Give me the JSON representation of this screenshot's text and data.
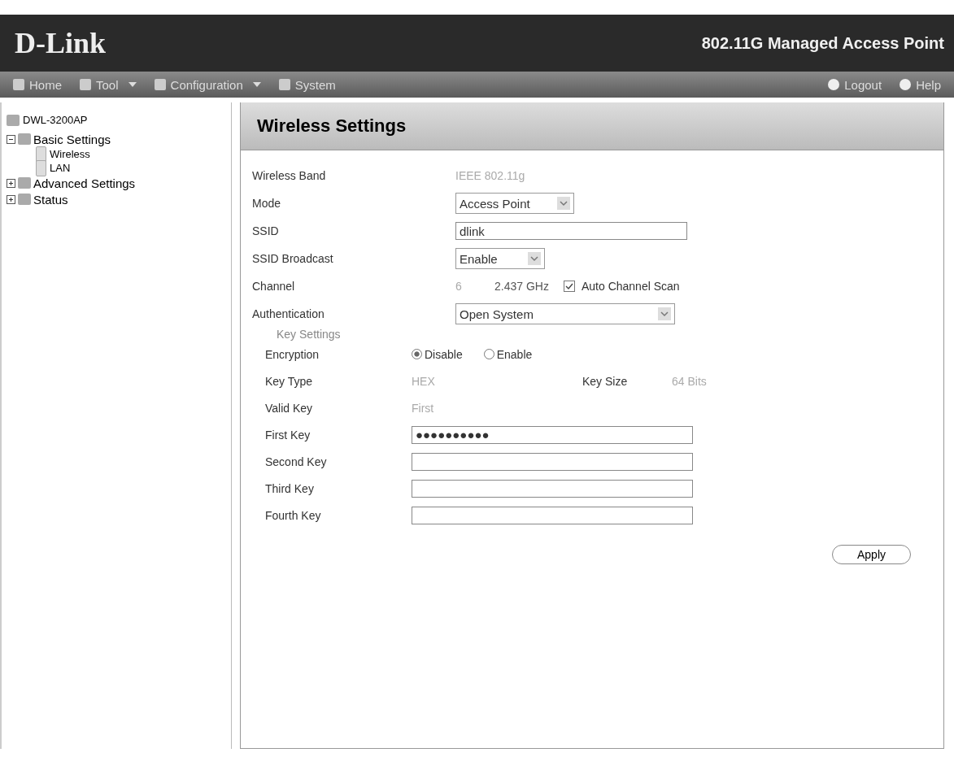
{
  "header": {
    "logo": "D-Link",
    "product": "802.11G Managed Access Point"
  },
  "nav": {
    "left": [
      {
        "label": "Home",
        "dropdown": false
      },
      {
        "label": "Tool",
        "dropdown": true
      },
      {
        "label": "Configuration",
        "dropdown": true
      },
      {
        "label": "System",
        "dropdown": false
      }
    ],
    "right": [
      {
        "label": "Logout"
      },
      {
        "label": "Help"
      }
    ]
  },
  "tree": {
    "root": "DWL-3200AP",
    "items": [
      {
        "label": "Basic Settings",
        "expanded": true,
        "children": [
          {
            "label": "Wireless"
          },
          {
            "label": "LAN"
          }
        ]
      },
      {
        "label": "Advanced Settings",
        "expanded": false
      },
      {
        "label": "Status",
        "expanded": false
      }
    ]
  },
  "panel": {
    "title": "Wireless Settings",
    "rows": [
      {
        "kind": "static",
        "label": "Wireless Band",
        "value": "IEEE 802.11g"
      },
      {
        "kind": "select",
        "label": "Mode",
        "value": "Access Point"
      },
      {
        "kind": "input",
        "label": "SSID",
        "value": "dlink"
      },
      {
        "kind": "select",
        "label": "SSID Broadcast",
        "value": "Enable"
      },
      {
        "kind": "channel",
        "label": "Channel",
        "value": "6",
        "freq": "2.437 GHz",
        "check_label": "Auto Channel Scan",
        "checked": true
      },
      {
        "kind": "select",
        "label": "Authentication",
        "value": "Open System"
      }
    ],
    "section": "Key Settings",
    "key_rows": [
      {
        "kind": "radio",
        "label": "Encryption",
        "options": [
          {
            "label": "Disable",
            "selected": true
          },
          {
            "label": "Enable",
            "selected": false
          }
        ]
      },
      {
        "kind": "pair",
        "label": "Key Type",
        "value": "HEX",
        "label2": "Key Size",
        "value2": "64 Bits"
      },
      {
        "kind": "static",
        "label": "Valid Key",
        "value": "First"
      },
      {
        "kind": "input",
        "label": "First Key",
        "value": "●●●●●●●●●●"
      },
      {
        "kind": "input",
        "label": "Second Key",
        "value": ""
      },
      {
        "kind": "input",
        "label": "Third Key",
        "value": ""
      },
      {
        "kind": "input",
        "label": "Fourth Key",
        "value": ""
      }
    ],
    "apply": "Apply"
  }
}
